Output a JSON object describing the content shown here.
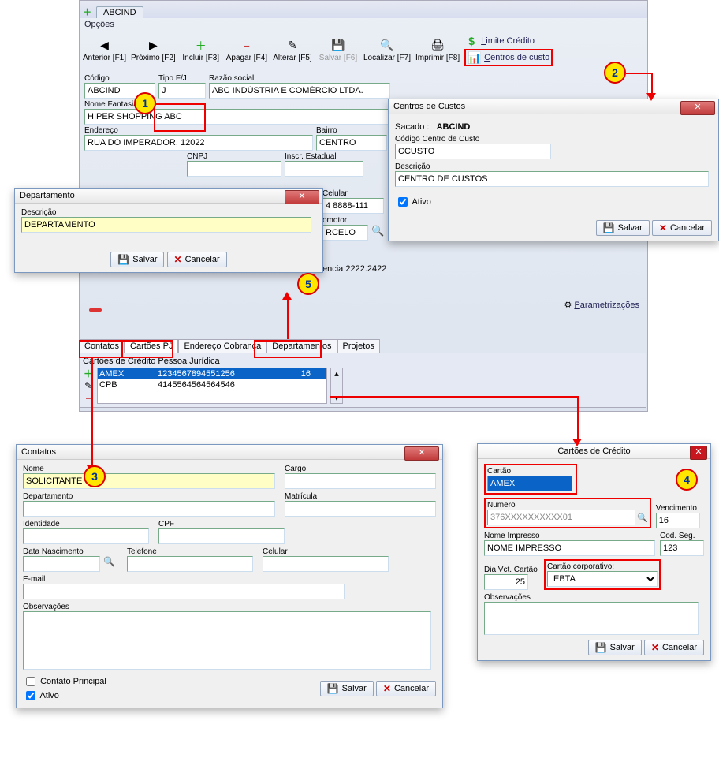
{
  "main": {
    "tab_name": "ABCIND",
    "opcoes": "Opções",
    "toolbar": {
      "anterior": "Anterior [F1]",
      "proximo": "Próximo [F2]",
      "incluir": "Incluir [F3]",
      "apagar": "Apagar [F4]",
      "alterar": "Alterar [F5]",
      "salvar": "Salvar [F6]",
      "localizar": "Localizar [F7]",
      "imprimir": "Imprimir [F8]",
      "limite_credito": "Limite Crédito",
      "centros_de_custo": "Centros de custo"
    },
    "fields": {
      "codigo_label": "Código",
      "codigo_value": "ABCIND",
      "tipofj_label": "Tipo F/J",
      "tipofj_value": "J",
      "razao_label": "Razão social",
      "razao_value": "ABC INDÚSTRIA E COMÉRCIO LTDA.",
      "nomefant_label": "Nome Fantasia",
      "nomefant_value": "HIPER SHOPPING ABC",
      "endereco_label": "Endereço",
      "endereco_value": "RUA DO IMPERADOR, 12022",
      "bairro_label": "Bairro",
      "bairro_value": "CENTRO",
      "cnpj_label": "CNPJ",
      "insc_label": "Inscr. Estadual",
      "celular_label": "Celular",
      "celular_value": "4 8888-111",
      "promotor_label": "omotor",
      "promotor_value": "RCELO",
      "agencia_value": "encia 2222.2422"
    },
    "param": "Parametrizações",
    "subtabs": {
      "contatos": "Contatos",
      "cartoes_pj": "Cartões PJ",
      "endereco": "Endereço Cobrança",
      "departamentos": "Departamentos",
      "projetos": "Projetos"
    },
    "cards_panel": {
      "title": "Cartões de Crédito Pessoa Jurídica",
      "rows": [
        {
          "brand": "AMEX",
          "number": "1234567894551256",
          "code": "16"
        },
        {
          "brand": "CPB",
          "number": "4145564564564546",
          "code": ""
        }
      ]
    }
  },
  "departamento_dlg": {
    "title": "Departamento",
    "descricao_label": "Descrição",
    "descricao_value": "DEPARTAMENTO",
    "salvar": "Salvar",
    "cancelar": "Cancelar"
  },
  "centros_dlg": {
    "title": "Centros de Custos",
    "sacado_label": "Sacado :",
    "sacado_value": "ABCIND",
    "codigo_label": "Código Centro de Custo",
    "codigo_value": "CCUSTO",
    "descricao_label": "Descrição",
    "descricao_value": "CENTRO DE CUSTOS",
    "ativo_label": "Ativo",
    "salvar": "Salvar",
    "cancelar": "Cancelar"
  },
  "contatos_dlg": {
    "title": "Contatos",
    "nome_label": "Nome",
    "nome_value": "SOLICITANTE",
    "cargo_label": "Cargo",
    "departamento_label": "Departamento",
    "matricula_label": "Matrícula",
    "identidade_label": "Identidade",
    "cpf_label": "CPF",
    "data_nasc_label": "Data Nascimento",
    "telefone_label": "Telefone",
    "celular_label": "Celular",
    "email_label": "E-mail",
    "obs_label": "Observações",
    "contato_principal": "Contato Principal",
    "ativo": "Ativo",
    "salvar": "Salvar",
    "cancelar": "Cancelar"
  },
  "cartao_dlg": {
    "title": "Cartões de Crédito",
    "cartao_label": "Cartão",
    "cartao_value": "AMEX",
    "numero_label": "Numero",
    "numero_value": "376XXXXXXXXXX01",
    "vencimento_label": "Vencimento",
    "vencimento_value": "16",
    "nome_impresso_label": "Nome Impresso",
    "nome_impresso_value": "NOME IMPRESSO",
    "cod_seg_label": "Cod. Seg.",
    "cod_seg_value": "123",
    "dia_vct_label": "Dia Vct. Cartão",
    "dia_vct_value": "25",
    "cartao_corp_label": "Cartão corporativo:",
    "cartao_corp_value": "EBTA",
    "obs_label": "Observações",
    "salvar": "Salvar",
    "cancelar": "Cancelar"
  },
  "badges": {
    "b1": "1",
    "b2": "2",
    "b3": "3",
    "b4": "4",
    "b5": "5"
  }
}
